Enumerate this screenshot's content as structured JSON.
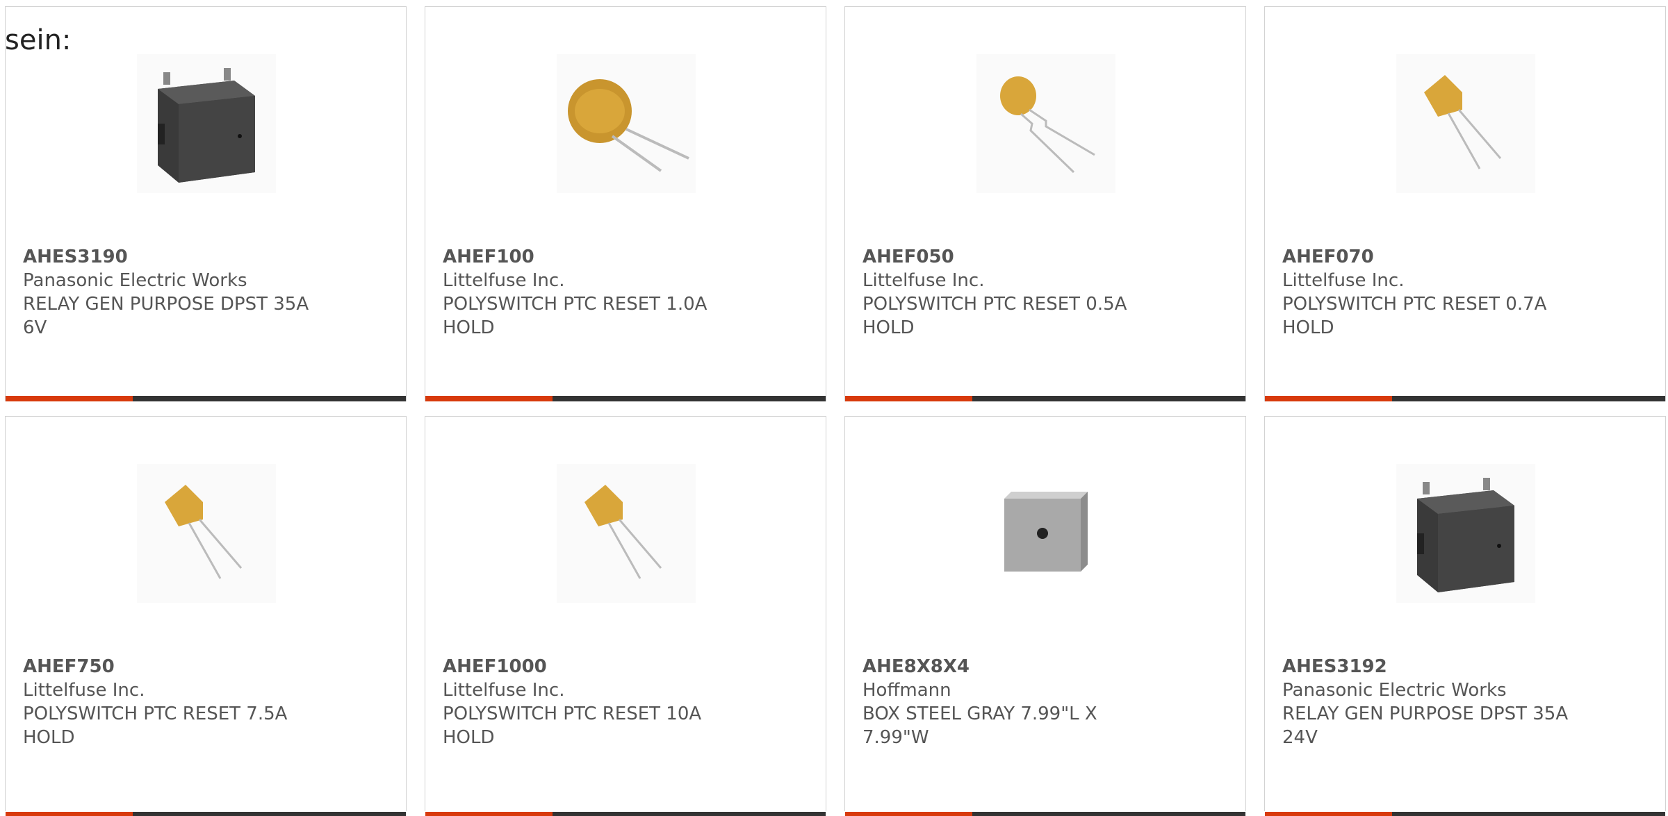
{
  "intro_text": "sein:",
  "colors": {
    "accent": "#d83a0c",
    "bar": "#333333",
    "border": "#d2d2d2",
    "text": "#555555"
  },
  "products": [
    {
      "part": "AHES3190",
      "maker": "Panasonic Electric Works",
      "desc": "RELAY GEN PURPOSE DPST 35A 6V",
      "icon": "relay-icon"
    },
    {
      "part": "AHEF100",
      "maker": "Littelfuse Inc.",
      "desc": "POLYSWITCH PTC RESET 1.0A HOLD",
      "icon": "ptc-disc-icon"
    },
    {
      "part": "AHEF050",
      "maker": "Littelfuse Inc.",
      "desc": "POLYSWITCH PTC RESET 0.5A HOLD",
      "icon": "ptc-small-icon"
    },
    {
      "part": "AHEF070",
      "maker": "Littelfuse Inc.",
      "desc": "POLYSWITCH PTC RESET 0.7A HOLD",
      "icon": "ptc-icon"
    },
    {
      "part": "AHEF750",
      "maker": "Littelfuse Inc.",
      "desc": "POLYSWITCH PTC RESET 7.5A HOLD",
      "icon": "ptc-icon"
    },
    {
      "part": "AHEF1000",
      "maker": "Littelfuse Inc.",
      "desc": "POLYSWITCH PTC RESET 10A HOLD",
      "icon": "ptc-icon"
    },
    {
      "part": "AHE8X8X4",
      "maker": "Hoffmann",
      "desc": "BOX STEEL GRAY 7.99\"L X 7.99\"W",
      "icon": "steel-box-icon"
    },
    {
      "part": "AHES3192",
      "maker": "Panasonic Electric Works",
      "desc": "RELAY GEN PURPOSE DPST 35A 24V",
      "icon": "relay-icon"
    }
  ]
}
